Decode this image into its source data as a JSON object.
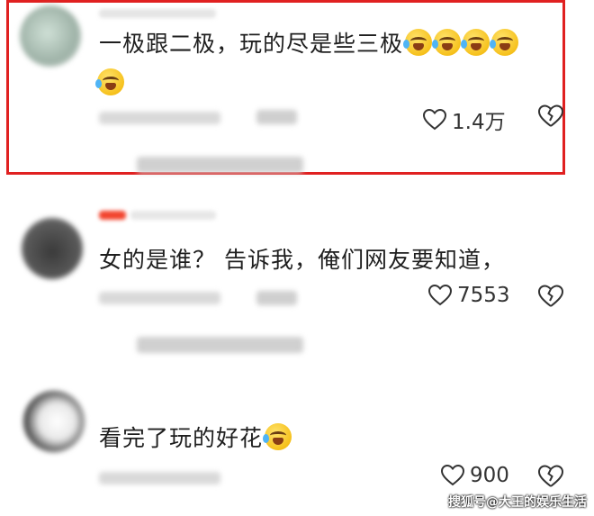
{
  "comments": [
    {
      "text": "一极跟二极，玩的尽是些三极",
      "likes": "1.4万",
      "emoji": "laugh-cry"
    },
    {
      "text": "女的是谁？ 告诉我，俺们网友要知道，",
      "likes": "7553"
    },
    {
      "text": "看完了玩的好花",
      "likes": "900",
      "emoji": "laugh-cry"
    }
  ],
  "highlight_color": "#e02020",
  "watermark": "搜狐号@大王的娱乐生活",
  "icons": [
    "heart-icon",
    "broken-heart-icon",
    "laugh-cry-emoji"
  ]
}
